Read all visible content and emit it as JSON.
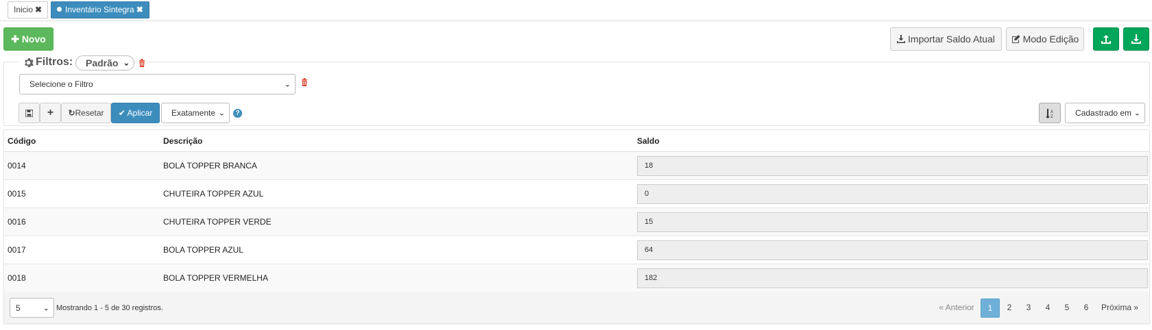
{
  "tabs": [
    {
      "label": "Inicio",
      "active": false
    },
    {
      "label": "Inventário Sintegra",
      "active": true
    }
  ],
  "toolbar": {
    "novo_label": "Novo",
    "importar_label": "Importar Saldo Atual",
    "modo_edicao_label": "Modo Edição"
  },
  "filters": {
    "legend_label": "Filtros:",
    "preset_value": "Padrão",
    "filter_select_placeholder": "Selecione o Filtro",
    "resetar_label": "Resetar",
    "aplicar_label": "Aplicar",
    "match_mode_value": "Exatamente",
    "sort_field_value": "Cadastrado em"
  },
  "table": {
    "columns": [
      "Código",
      "Descrição",
      "Saldo"
    ],
    "rows": [
      {
        "codigo": "0014",
        "descricao": "BOLA TOPPER BRANCA",
        "saldo": "18"
      },
      {
        "codigo": "0015",
        "descricao": "CHUTEIRA TOPPER AZUL",
        "saldo": "0"
      },
      {
        "codigo": "0016",
        "descricao": "CHUTEIRA TOPPER VERDE",
        "saldo": "15"
      },
      {
        "codigo": "0017",
        "descricao": "BOLA TOPPER AZUL",
        "saldo": "64"
      },
      {
        "codigo": "0018",
        "descricao": "BOLA TOPPER VERMELHA",
        "saldo": "182"
      }
    ]
  },
  "pagination": {
    "page_size_value": "5",
    "info_text": "Mostrando 1 - 5 de 30 registros.",
    "prev_label": "« Anterior",
    "pages": [
      "1",
      "2",
      "3",
      "4",
      "5",
      "6"
    ],
    "current_page": "1",
    "next_label": "Próxima »"
  },
  "colors": {
    "primary_blue": "#3c8dbc",
    "success_green": "#00a65a",
    "novo_green": "#5cb85c",
    "danger_red": "#dd4b39"
  }
}
